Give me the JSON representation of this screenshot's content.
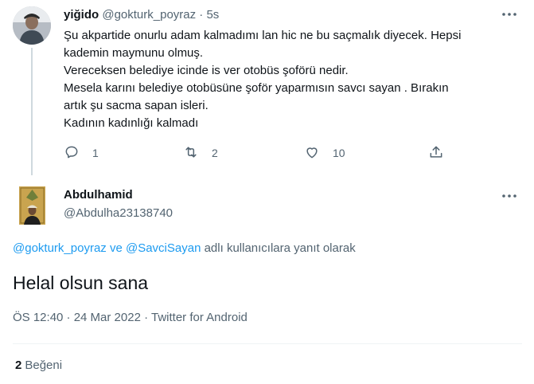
{
  "parent_tweet": {
    "author_name": "yiğido",
    "author_handle": "@gokturk_poyraz",
    "separator": "·",
    "time": "5s",
    "lines": [
      "Şu akpartide onurlu adam kalmadımı lan hic ne bu saçmalık diyecek. Hepsi",
      "kademin maymunu olmuş.",
      "Vereceksen belediye icinde is ver otobüs şoförü nedir.",
      "Mesela karını belediye otobüsüne şoför yaparmısın savcı sayan . Bırakın",
      "artık şu sacma sapan isleri.",
      "Kadının kadınlığı kalmadı"
    ],
    "actions": {
      "reply_count": "1",
      "retweet_count": "2",
      "like_count": "10"
    }
  },
  "reply_tweet": {
    "author_name": "Abdulhamid",
    "author_handle": "@Abdulha23138740",
    "replying_to": {
      "mention1": "@gokturk_poyraz",
      "connector": "ve",
      "mention2": "@SavciSayan",
      "suffix": "adlı kullanıcılara yanıt olarak"
    },
    "text": "Helal olsun sana",
    "meta": "ÖS 12:40 · 24 Mar 2022 · Twitter for Android",
    "likes_count": "2",
    "likes_label": "Beğeni"
  },
  "colors": {
    "text_primary": "#0f1419",
    "text_secondary": "#536471",
    "link": "#1d9bf0",
    "divider": "#eff3f4",
    "thread_line": "#cfd9de"
  },
  "icons": {
    "more": "more-icon",
    "reply": "reply-icon",
    "retweet": "retweet-icon",
    "like": "like-icon",
    "share": "share-icon"
  }
}
